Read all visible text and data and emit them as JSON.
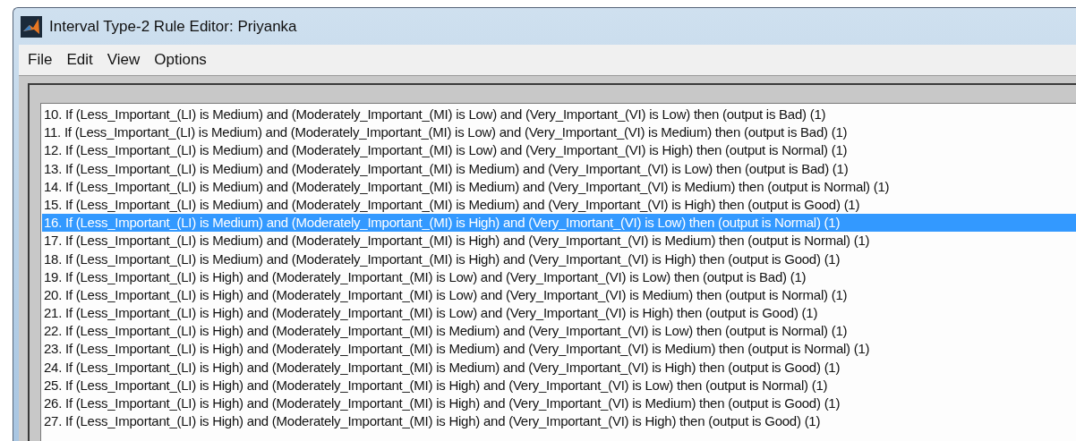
{
  "window": {
    "title": "Interval Type-2 Rule Editor: Priyanka"
  },
  "menu": [
    "File",
    "Edit",
    "View",
    "Options"
  ],
  "rules": [
    {
      "text": "10. If (Less_Important_(LI) is Medium) and (Moderately_Important_(MI) is Low) and (Very_Important_(VI) is Low) then (output is Bad) (1)",
      "selected": false
    },
    {
      "text": "11. If (Less_Important_(LI) is Medium) and (Moderately_Important_(MI) is Low) and (Very_Important_(VI) is Medium) then (output is Bad) (1)",
      "selected": false
    },
    {
      "text": "12. If (Less_Important_(LI) is Medium) and (Moderately_Important_(MI) is Low) and (Very_Important_(VI) is High) then (output is Normal) (1)",
      "selected": false
    },
    {
      "text": "13. If (Less_Important_(LI) is Medium) and (Moderately_Important_(MI) is Medium) and (Very_Important_(VI) is Low) then (output is Bad) (1)",
      "selected": false
    },
    {
      "text": "14. If (Less_Important_(LI) is Medium) and (Moderately_Important_(MI) is Medium) and (Very_Important_(VI) is Medium) then (output is Normal) (1)",
      "selected": false
    },
    {
      "text": "15. If (Less_Important_(LI) is Medium) and (Moderately_Important_(MI) is Medium) and (Very_Important_(VI) is High) then (output is Good) (1)",
      "selected": false
    },
    {
      "text": "16. If (Less_Important_(LI) is Medium) and (Moderately_Important_(MI) is High) and (Very_Imortant_(VI) is Low) then (output is Normal) (1)",
      "selected": true
    },
    {
      "text": "17. If (Less_Important_(LI) is Medium) and (Moderately_Important_(MI) is High) and (Very_Important_(VI) is Medium) then (output is Normal) (1)",
      "selected": false
    },
    {
      "text": "18. If (Less_Important_(LI) is Medium) and (Moderately_Important_(MI) is High) and (Very_Important_(VI) is High) then (output is Good) (1)",
      "selected": false
    },
    {
      "text": "19. If (Less_Important_(LI) is High) and (Moderately_Important_(MI) is Low) and (Very_Important_(VI) is Low) then (output is Bad) (1)",
      "selected": false
    },
    {
      "text": "20. If (Less_Important_(LI) is High) and (Moderately_Important_(MI) is Low) and (Very_Important_(VI) is Medium) then (output is Normal) (1)",
      "selected": false
    },
    {
      "text": "21. If (Less_Important_(LI) is High) and (Moderately_Important_(MI) is Low) and (Very_Important_(VI) is High) then (output is Good) (1)",
      "selected": false
    },
    {
      "text": "22. If (Less_Important_(LI) is High) and (Moderately_Important_(MI) is Medium) and (Very_Important_(VI) is Low) then (output is Normal) (1)",
      "selected": false
    },
    {
      "text": "23. If (Less_Important_(LI) is High) and (Moderately_Important_(MI) is Medium) and (Very_Important_(VI) is Medium) then (output is Normal) (1)",
      "selected": false
    },
    {
      "text": "24. If (Less_Important_(LI) is High) and (Moderately_Important_(MI) is Medium) and (Very_Important_(VI) is High) then (output is Good) (1)",
      "selected": false
    },
    {
      "text": "25. If (Less_Important_(LI) is High) and (Moderately_Important_(MI) is High) and (Very_Important_(VI) is Low) then (output is Normal) (1)",
      "selected": false
    },
    {
      "text": "26. If (Less_Important_(LI) is High) and (Moderately_Important_(MI) is High) and (Very_Important_(VI) is Medium) then (output is Good) (1)",
      "selected": false
    },
    {
      "text": "27. If (Less_Important_(LI) is High) and (Moderately_Important_(MI) is High) and (Very_Important_(VI) is High) then (output is Good) (1)",
      "selected": false
    }
  ]
}
